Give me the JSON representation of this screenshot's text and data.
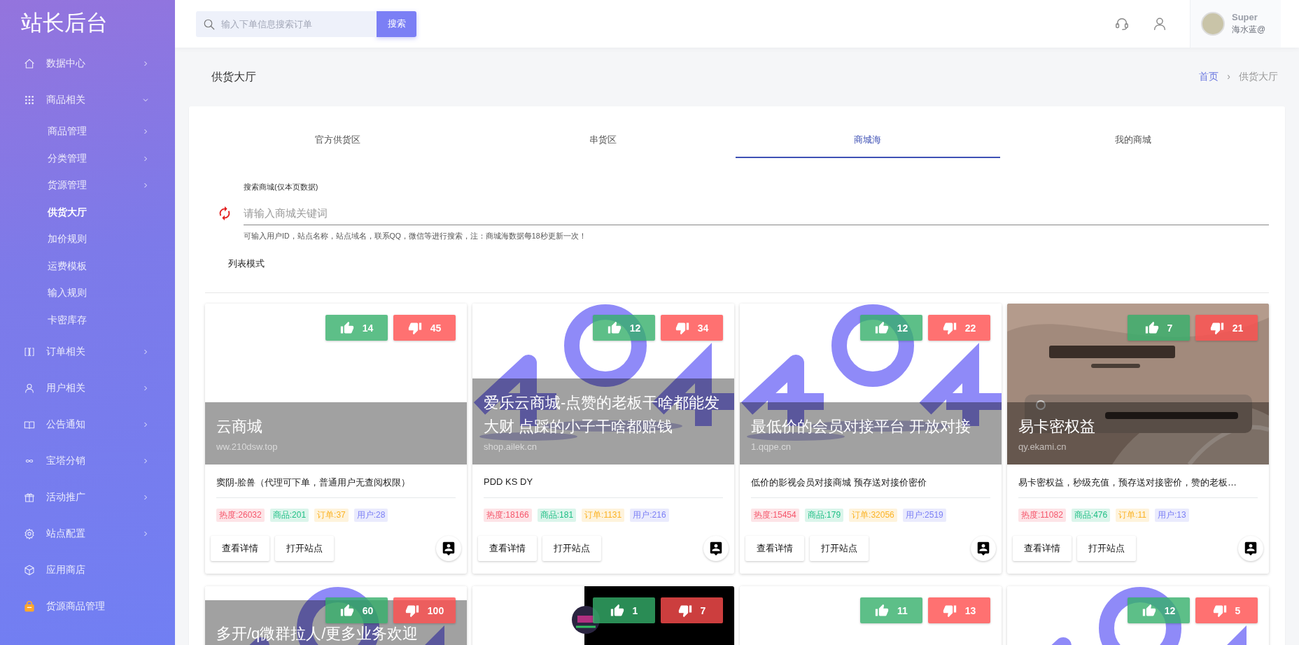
{
  "sidebar": {
    "title": "站长后台",
    "items": [
      {
        "label": "数据中心",
        "expanded": false,
        "selected": false
      },
      {
        "label": "商品相关",
        "expanded": true,
        "selected": false,
        "children": [
          {
            "label": "商品管理",
            "expanded": false,
            "selected": false
          },
          {
            "label": "分类管理",
            "expanded": false,
            "selected": false
          },
          {
            "label": "货源管理",
            "expanded": false,
            "selected": false
          },
          {
            "label": "供货大厅",
            "selected": true
          },
          {
            "label": "加价规则",
            "selected": false
          },
          {
            "label": "运费模板",
            "selected": false
          },
          {
            "label": "输入规则",
            "selected": false
          },
          {
            "label": "卡密库存",
            "selected": false
          }
        ]
      },
      {
        "label": "订单相关",
        "expanded": false,
        "selected": false
      },
      {
        "label": "用户相关",
        "expanded": false,
        "selected": false
      },
      {
        "label": "公告通知",
        "expanded": false,
        "selected": false
      },
      {
        "label": "宝塔分销",
        "expanded": false,
        "selected": false
      },
      {
        "label": "活动推广",
        "expanded": false,
        "selected": false
      },
      {
        "label": "站点配置",
        "expanded": false,
        "selected": false
      },
      {
        "label": "应用商店",
        "selected": false
      },
      {
        "label": "货源商品管理",
        "selected": false
      }
    ]
  },
  "header": {
    "search": {
      "placeholder": "输入下单信息搜索订单"
    },
    "search_button": "搜索",
    "user": {
      "name": "Super",
      "subtitle": "海水蓝@"
    }
  },
  "page": {
    "title": "供货大厅",
    "breadcrumb": [
      "首页",
      "›",
      "供货大厅"
    ]
  },
  "tabs": [
    {
      "label": "官方供货区",
      "selected": false
    },
    {
      "label": "串货区",
      "selected": false
    },
    {
      "label": "商城海",
      "selected": true
    },
    {
      "label": "我的商城",
      "selected": false
    }
  ],
  "shop_search": {
    "label": "搜索商城(仅本页数据)",
    "placeholder": "请输入商城关键词",
    "hint": "可输入用户ID，站点名称，站点域名，联系QQ，微信等进行搜索，注：商城海数据每18秒更新一次！"
  },
  "view_mode": "列表模式",
  "cards": [
    {
      "likes": "14",
      "dislikes": "45",
      "title": "云商城",
      "url": "ww.210dsw.top",
      "description": "窦阴-脍兽（代理可下单，普通用户无查阅权限）",
      "tags": [
        {
          "text": "热度:26032",
          "color": "#f5576c"
        },
        {
          "text": "商品:201",
          "color": "#1fbf85"
        },
        {
          "text": "订单:37",
          "color": "#fbb324"
        },
        {
          "text": "用户:28",
          "color": "#7b7ff5"
        }
      ],
      "actions": [
        "查看详情",
        "打开站点"
      ]
    },
    {
      "image": {
        "kind": "picture"
      },
      "likes": "12",
      "dislikes": "34",
      "title": "爱乐云商城-点赞的老板干啥都能发大财 点踩的小子干啥都赔钱",
      "url": "shop.ailek.cn",
      "description": "PDD KS DY",
      "tags": [
        {
          "text": "热度:18166",
          "color": "#f5576c"
        },
        {
          "text": "商品:181",
          "color": "#1fbf85"
        },
        {
          "text": "订单:1131",
          "color": "#fbb324"
        },
        {
          "text": "用户:216",
          "color": "#7b7ff5"
        }
      ],
      "actions": [
        "查看详情",
        "打开站点"
      ]
    },
    {
      "image": {
        "kind": "picture"
      },
      "likes": "12",
      "dislikes": "22",
      "title": "最低价的会员对接平台 开放对接",
      "url": "1.qqpe.cn",
      "description": "低价的影视会员对接商城 预存送对接价密价",
      "tags": [
        {
          "text": "热度:15454",
          "color": "#f5576c"
        },
        {
          "text": "商品:179",
          "color": "#1fbf85"
        },
        {
          "text": "订单:32056",
          "color": "#fbb324"
        },
        {
          "text": "用户:2519",
          "color": "#7b7ff5"
        }
      ],
      "actions": [
        "查看详情",
        "打开站点"
      ]
    },
    {
      "image": {
        "kind": "picture"
      },
      "likes": "7",
      "dislikes": "21",
      "title": "易卡密权益",
      "url": "qy.ekami.cn",
      "description": "易卡密权益，秒级充值，预存送对接密价，赞的老板…",
      "tags": [
        {
          "text": "热度:11082",
          "color": "#f5576c"
        },
        {
          "text": "商品:476",
          "color": "#1fbf85"
        },
        {
          "text": "订单:11",
          "color": "#fbb324"
        },
        {
          "text": "用户:13",
          "color": "#7b7ff5"
        }
      ],
      "actions": [
        "查看详情",
        "打开站点"
      ]
    },
    {
      "image": {
        "kind": "picture"
      },
      "likes": "60",
      "dislikes": "100",
      "title": "多开/q微群拉人/更多业务欢迎"
    },
    {
      "image": {
        "kind": "picture"
      },
      "likes": "1",
      "dislikes": "7"
    },
    {
      "likes": "11",
      "dislikes": "13"
    },
    {
      "image": {
        "kind": "picture"
      },
      "likes": "12",
      "dislikes": "5"
    }
  ]
}
